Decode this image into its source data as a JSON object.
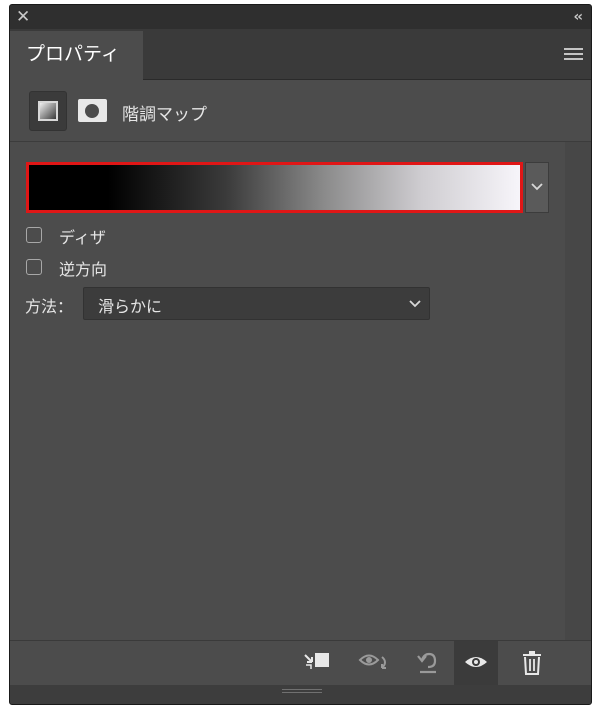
{
  "window": {
    "close_icon": "close-icon",
    "collapse_icon": "double-chevron-icon"
  },
  "tab": {
    "label": "プロパティ"
  },
  "panel_menu_icon": "hamburger-icon",
  "adjustment": {
    "title": "階調マップ",
    "layer_icon": "adjustment-layer-icon",
    "mask_icon": "layer-mask-icon"
  },
  "gradient": {
    "stops": [
      "#000000",
      "#f7f5fa"
    ],
    "highlight_color": "#e01616",
    "dropdown_icon": "chevron-down-icon"
  },
  "options": {
    "dither": {
      "label": "ディザ",
      "checked": false
    },
    "reverse": {
      "label": "逆方向",
      "checked": false
    }
  },
  "method": {
    "label": "方法：",
    "value": "滑らかに"
  },
  "bottom_toolbar": [
    {
      "name": "clip-to-layer-icon"
    },
    {
      "name": "view-previous-state-icon"
    },
    {
      "name": "reset-icon"
    },
    {
      "name": "visibility-eye-icon",
      "active": true
    },
    {
      "name": "trash-icon"
    }
  ]
}
